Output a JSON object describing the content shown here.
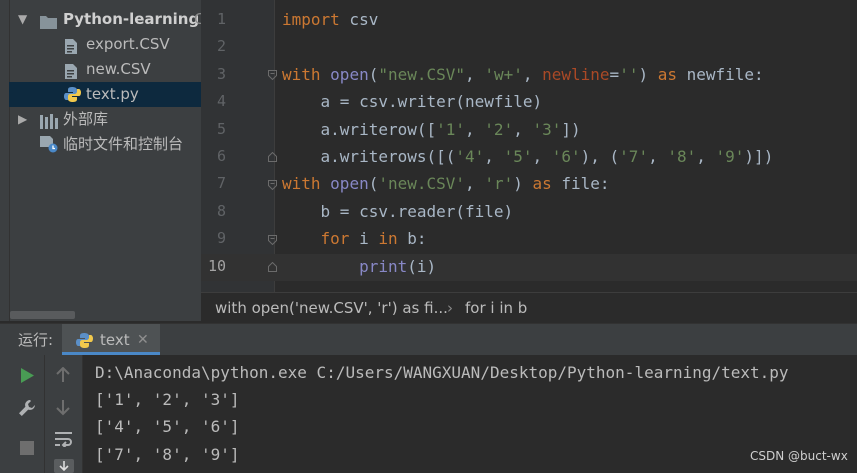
{
  "project_tree": {
    "root": {
      "name": "Python-learning",
      "suffix": "C"
    },
    "files": [
      {
        "name": "export.CSV"
      },
      {
        "name": "new.CSV"
      },
      {
        "name": "text.py"
      }
    ],
    "external_libraries": "外部库",
    "scratches": "临时文件和控制台"
  },
  "editor": {
    "line_numbers": [
      "1",
      "2",
      "3",
      "4",
      "5",
      "6",
      "7",
      "8",
      "9",
      "10"
    ],
    "current_line": "10",
    "code_lines": [
      [
        {
          "t": "import",
          "c": "kw"
        },
        {
          "t": " csv",
          "c": "p"
        }
      ],
      [],
      [
        {
          "t": "with",
          "c": "kw"
        },
        {
          "t": " ",
          "c": "p"
        },
        {
          "t": "open",
          "c": "bi"
        },
        {
          "t": "(",
          "c": "p"
        },
        {
          "t": "\"new.CSV\"",
          "c": "str"
        },
        {
          "t": ", ",
          "c": "p"
        },
        {
          "t": "'w+'",
          "c": "str"
        },
        {
          "t": ", ",
          "c": "p"
        },
        {
          "t": "newline",
          "c": "param"
        },
        {
          "t": "=",
          "c": "p"
        },
        {
          "t": "''",
          "c": "str"
        },
        {
          "t": ") ",
          "c": "p"
        },
        {
          "t": "as",
          "c": "kw"
        },
        {
          "t": " newfile:",
          "c": "p"
        }
      ],
      [
        {
          "t": "    a = csv.writer(newfile)",
          "c": "p"
        }
      ],
      [
        {
          "t": "    a.writerow([",
          "c": "p"
        },
        {
          "t": "'1'",
          "c": "str"
        },
        {
          "t": ", ",
          "c": "p"
        },
        {
          "t": "'2'",
          "c": "str"
        },
        {
          "t": ", ",
          "c": "p"
        },
        {
          "t": "'3'",
          "c": "str"
        },
        {
          "t": "])",
          "c": "p"
        }
      ],
      [
        {
          "t": "    a.writerows([(",
          "c": "p"
        },
        {
          "t": "'4'",
          "c": "str"
        },
        {
          "t": ", ",
          "c": "p"
        },
        {
          "t": "'5'",
          "c": "str"
        },
        {
          "t": ", ",
          "c": "p"
        },
        {
          "t": "'6'",
          "c": "str"
        },
        {
          "t": "), (",
          "c": "p"
        },
        {
          "t": "'7'",
          "c": "str"
        },
        {
          "t": ", ",
          "c": "p"
        },
        {
          "t": "'8'",
          "c": "str"
        },
        {
          "t": ", ",
          "c": "p"
        },
        {
          "t": "'9'",
          "c": "str"
        },
        {
          "t": ")])",
          "c": "p"
        }
      ],
      [
        {
          "t": "with",
          "c": "kw"
        },
        {
          "t": " ",
          "c": "p"
        },
        {
          "t": "open",
          "c": "bi"
        },
        {
          "t": "(",
          "c": "p"
        },
        {
          "t": "'new.CSV'",
          "c": "str"
        },
        {
          "t": ", ",
          "c": "p"
        },
        {
          "t": "'r'",
          "c": "str"
        },
        {
          "t": ") ",
          "c": "p"
        },
        {
          "t": "as",
          "c": "kw"
        },
        {
          "t": " file:",
          "c": "p"
        }
      ],
      [
        {
          "t": "    b = csv.reader(file)",
          "c": "p"
        }
      ],
      [
        {
          "t": "    ",
          "c": "p"
        },
        {
          "t": "for",
          "c": "kw"
        },
        {
          "t": " i ",
          "c": "p"
        },
        {
          "t": "in",
          "c": "kw"
        },
        {
          "t": " b:",
          "c": "p"
        }
      ],
      [
        {
          "t": "        ",
          "c": "p"
        },
        {
          "t": "print",
          "c": "bi"
        },
        {
          "t": "(i)",
          "c": "p"
        }
      ]
    ]
  },
  "breadcrumb": {
    "item1": "with open('new.CSV', 'r') as fi...",
    "separator": "›",
    "item2": "for i in b"
  },
  "run": {
    "label": "运行:",
    "tab_name": "text",
    "close": "✕",
    "output": [
      "D:\\Anaconda\\python.exe C:/Users/WANGXUAN/Desktop/Python-learning/text.py",
      "['1', '2', '3']",
      "['4', '5', '6']",
      "['7', '8', '9']"
    ]
  },
  "watermark": "CSDN @buct-wx",
  "colors": {
    "keyword": "#cc7832",
    "string": "#6a8759",
    "builtin": "#8888c6",
    "param": "#aa4926",
    "plain": "#a9b7c6",
    "selection": "#0d293e",
    "run_green": "#499c54"
  }
}
